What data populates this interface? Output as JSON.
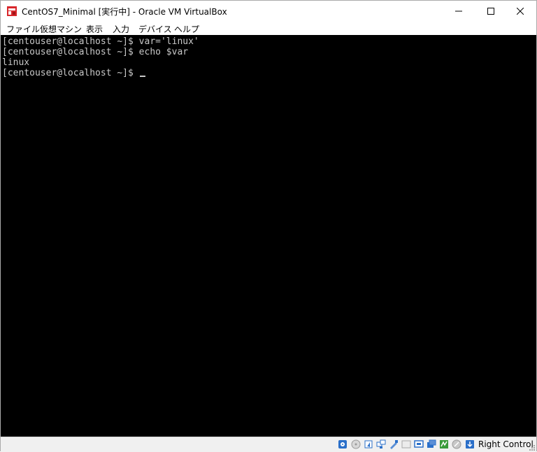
{
  "window": {
    "title": "CentOS7_Minimal [実行中] - Oracle VM VirtualBox"
  },
  "menu": {
    "items": [
      "ファイル",
      "仮想マシン",
      "表示",
      "入力",
      "デバイス",
      "ヘルプ"
    ]
  },
  "console": {
    "lines": [
      "[centouser@localhost ~]$ var='linux'",
      "[centouser@localhost ~]$ echo $var",
      "linux",
      "[centouser@localhost ~]$ "
    ]
  },
  "statusbar": {
    "icons": [
      "hard-disk-icon",
      "optical-drive-icon",
      "audio-icon",
      "network-icon",
      "usb-icon",
      "shared-folders-icon",
      "display-icon",
      "video-capture-icon",
      "cpu-icon",
      "mouse-integration-icon",
      "keyboard-capture-icon"
    ],
    "host_key": "Right Control"
  },
  "colors": {
    "console_bg": "#000000",
    "console_text": "#c8c8c8",
    "statusbar_bg": "#f0f0f0"
  }
}
